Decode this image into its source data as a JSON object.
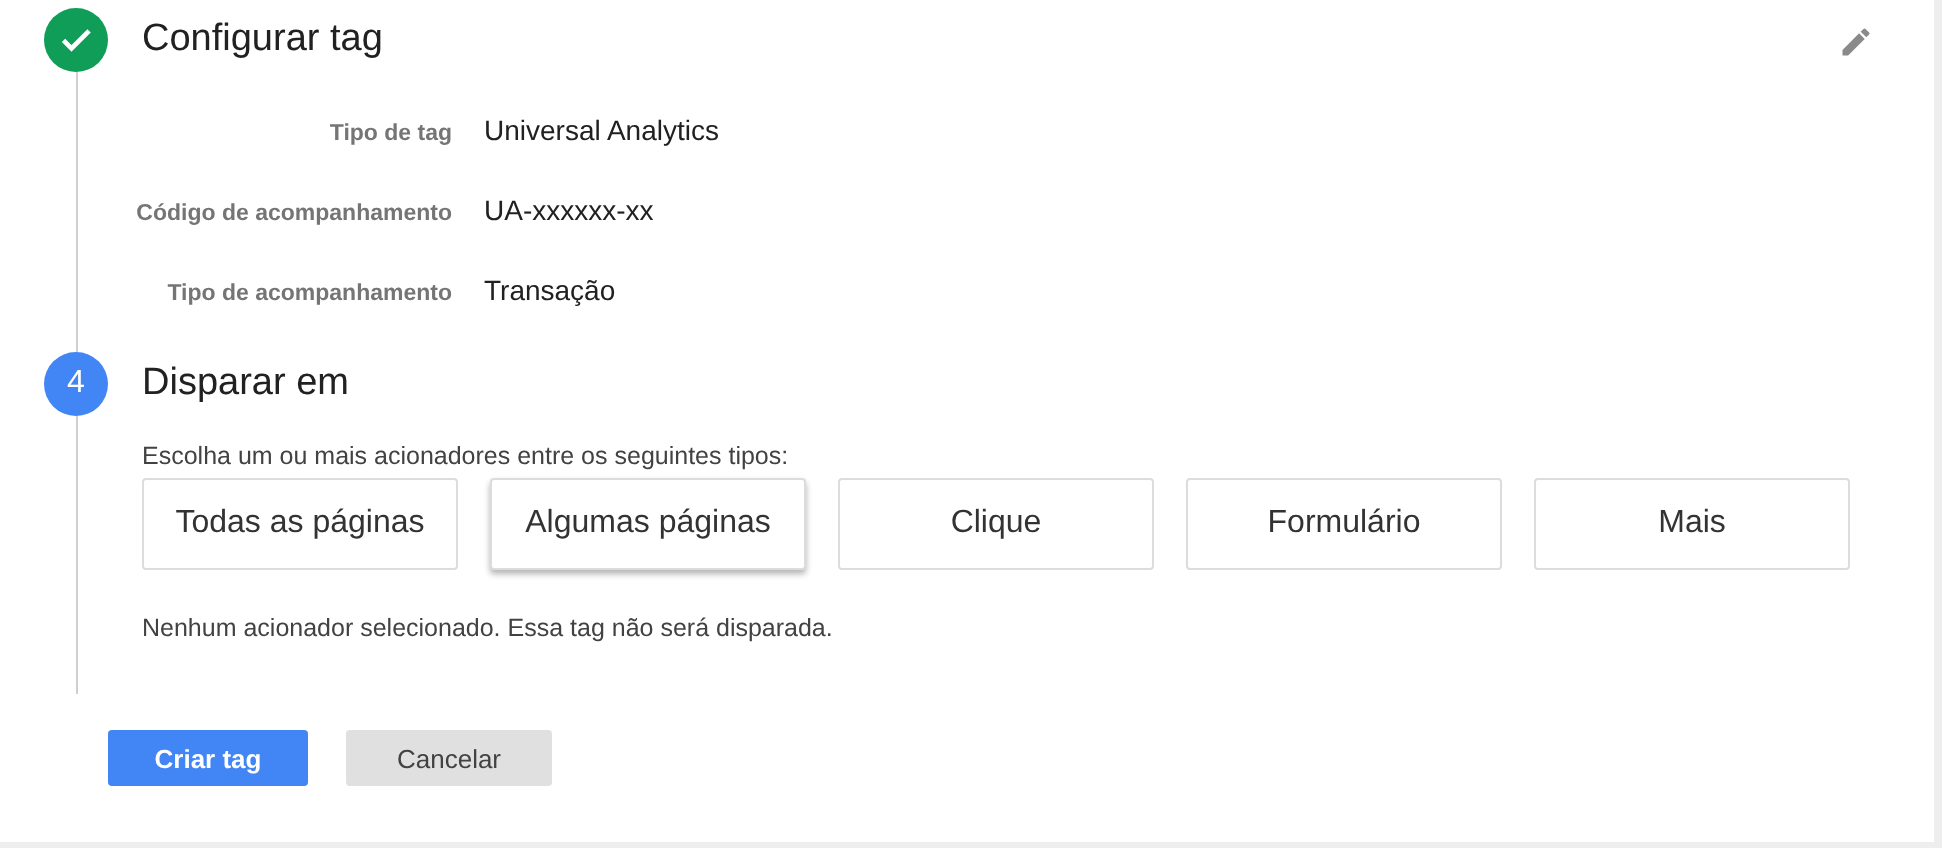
{
  "steps": [
    {
      "kind": "done",
      "title": "Configurar tag",
      "details": [
        {
          "label": "Tipo de tag",
          "value": "Universal Analytics"
        },
        {
          "label": "Código de acompanhamento",
          "value": "UA-xxxxxx-xx"
        },
        {
          "label": "Tipo de acompanhamento",
          "value": "Transação"
        }
      ]
    },
    {
      "kind": "number",
      "number": "4",
      "title": "Disparar em",
      "instruction": "Escolha um ou mais acionadores entre os seguintes tipos:",
      "triggers": [
        {
          "label": "Todas as páginas",
          "selected": false
        },
        {
          "label": "Algumas páginas",
          "selected": true
        },
        {
          "label": "Clique",
          "selected": false
        },
        {
          "label": "Formulário",
          "selected": false
        },
        {
          "label": "Mais",
          "selected": false
        }
      ],
      "note": "Nenhum acionador selecionado. Essa tag não será disparada."
    }
  ],
  "buttons": [
    {
      "label": "Criar tag",
      "kind": "primary"
    },
    {
      "label": "Cancelar",
      "kind": "secondary"
    }
  ]
}
